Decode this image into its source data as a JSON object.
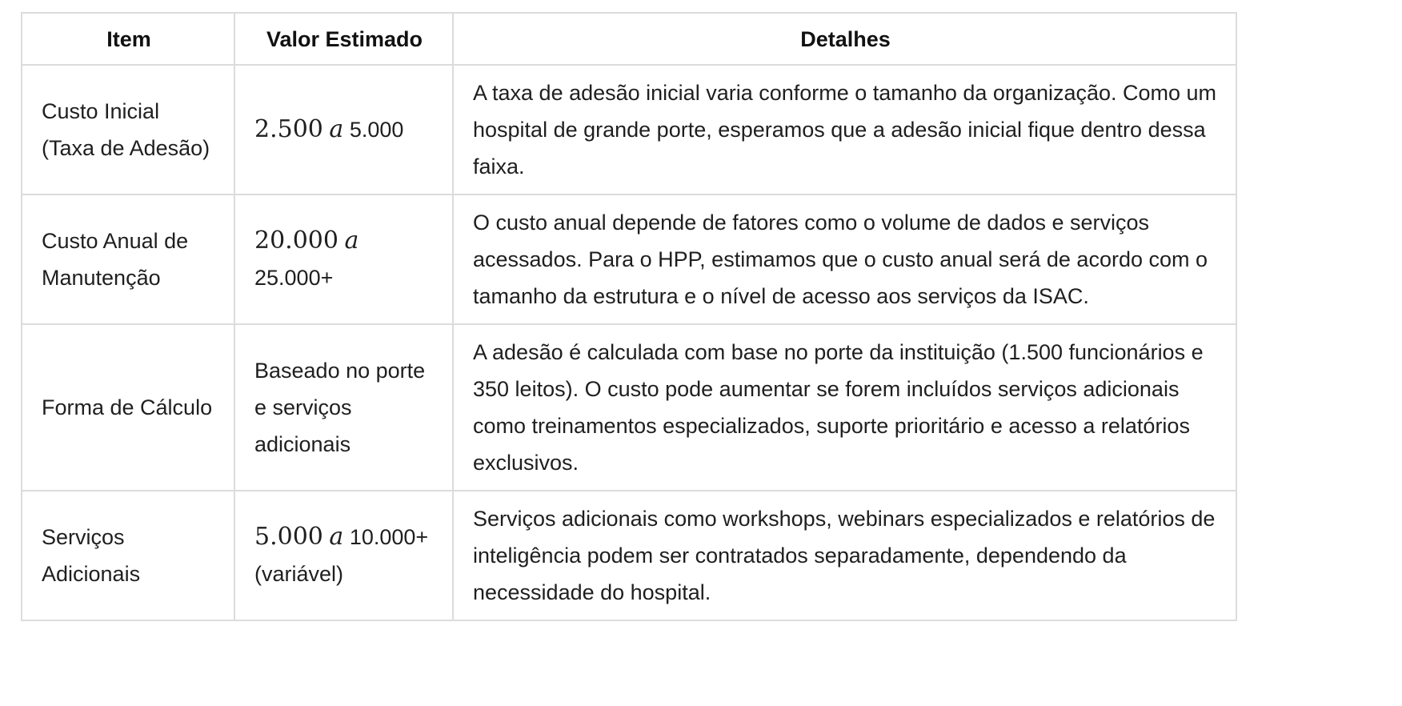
{
  "table": {
    "headers": {
      "item": "Item",
      "valor": "Valor Estimado",
      "detalhes": "Detalhes"
    },
    "rows": [
      {
        "item": "Custo Inicial (Taxa de Adesão)",
        "valor_math_1": "2.500",
        "valor_math_var": "a",
        "valor_rest": "5.000",
        "detalhes": "A taxa de adesão inicial varia conforme o tamanho da organização. Como um hospital de grande porte, esperamos que a adesão inicial fique dentro dessa faixa."
      },
      {
        "item": "Custo Anual de Manutenção",
        "valor_math_1": "20.000",
        "valor_math_var": "a",
        "valor_rest": "25.000+",
        "detalhes": "O custo anual depende de fatores como o volume de dados e serviços acessados. Para o HPP, estimamos que o custo anual será de acordo com o tamanho da estrutura e o nível de acesso aos serviços da ISAC."
      },
      {
        "item": "Forma de Cálculo",
        "valor_text": "Baseado no porte e serviços adicionais",
        "detalhes": "A adesão é calculada com base no porte da instituição (1.500 funcionários e 350 leitos). O custo pode aumentar se forem incluídos serviços adicionais como treinamentos especializados, suporte prioritário e acesso a relatórios exclusivos."
      },
      {
        "item": "Serviços Adicionais",
        "valor_math_1": "5.000",
        "valor_math_var": "a",
        "valor_rest": "10.000+ (variável)",
        "detalhes": "Serviços adicionais como workshops, webinars especializados e relatórios de inteligência podem ser contratados separadamente, dependendo da necessidade do hospital."
      }
    ]
  }
}
